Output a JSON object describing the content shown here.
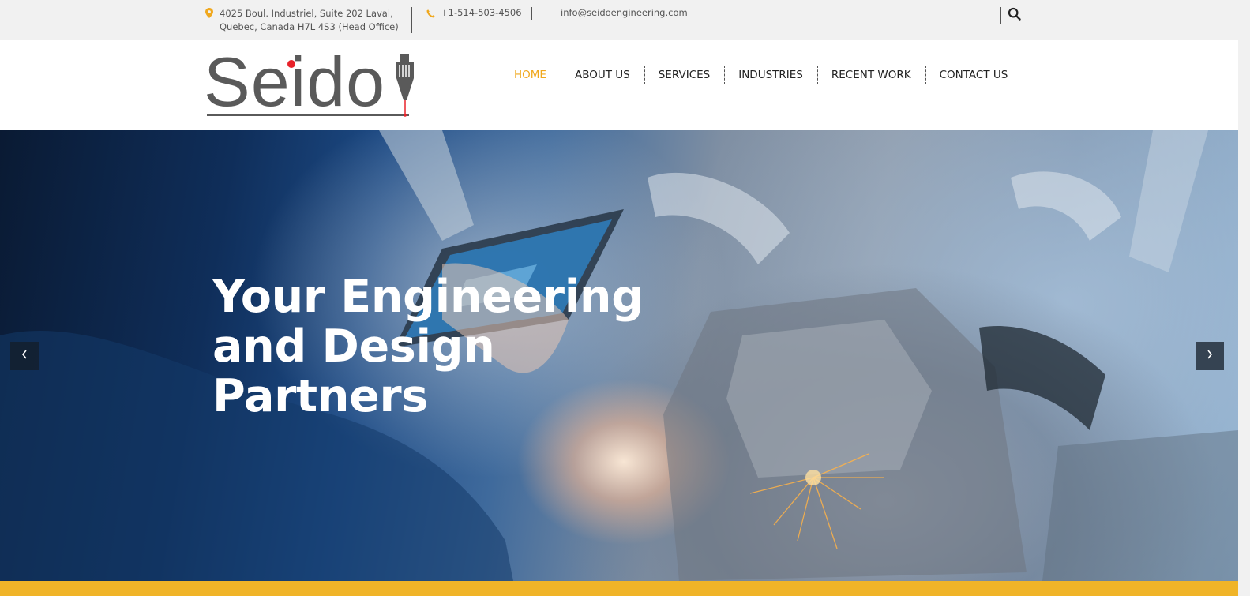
{
  "topbar": {
    "address_line1": "4025 Boul. Industriel, Suite 202 Laval,",
    "address_line2": "Quebec, Canada H7L 4S3 (Head Office)",
    "address_icon": "map-pin-icon",
    "phone": "+1-514-503-4506",
    "phone_icon": "phone-icon",
    "email": "info@seidoengineering.com",
    "search_icon": "search-icon",
    "accent_color": "#f0a81e"
  },
  "header": {
    "logo_text": "Seido",
    "logo_dot_color": "#e8222a",
    "nav": [
      {
        "label": "HOME",
        "active": true
      },
      {
        "label": "ABOUT US",
        "active": false
      },
      {
        "label": "SERVICES",
        "active": false
      },
      {
        "label": "INDUSTRIES",
        "active": false
      },
      {
        "label": "RECENT WORK",
        "active": false
      },
      {
        "label": "CONTACT US",
        "active": false
      }
    ]
  },
  "hero": {
    "headline_line1": "Your Engineering",
    "headline_line2": "and Design",
    "headline_line3": "Partners",
    "prev_arrow": "‹",
    "next_arrow": "›",
    "bottom_bar_color": "#f0b428"
  }
}
